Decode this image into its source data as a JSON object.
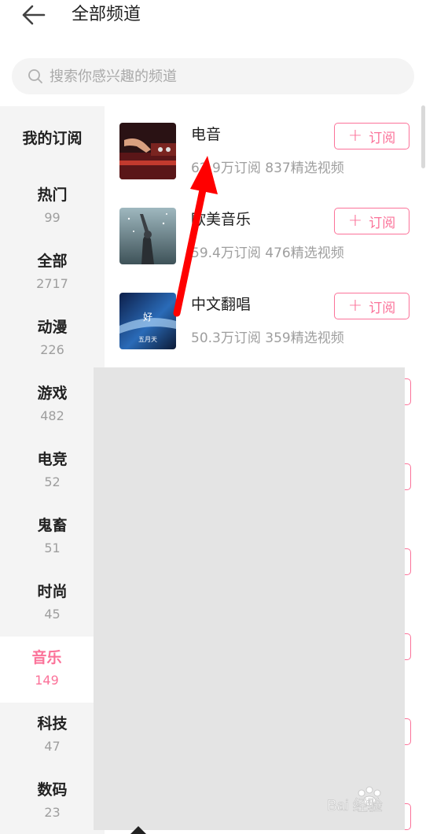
{
  "header": {
    "title": "全部频道",
    "back_icon": "arrow-left-icon"
  },
  "search": {
    "placeholder": "搜索你感兴趣的频道",
    "icon": "search-icon"
  },
  "sidebar": {
    "my_subscriptions": "我的订阅",
    "items": [
      {
        "label": "热门",
        "count": "99"
      },
      {
        "label": "全部",
        "count": "2717"
      },
      {
        "label": "动漫",
        "count": "226"
      },
      {
        "label": "游戏",
        "count": "482"
      },
      {
        "label": "电竞",
        "count": "52"
      },
      {
        "label": "鬼畜",
        "count": "51"
      },
      {
        "label": "时尚",
        "count": "45"
      },
      {
        "label": "音乐",
        "count": "149",
        "active": true
      },
      {
        "label": "科技",
        "count": "47"
      },
      {
        "label": "数码",
        "count": "23"
      }
    ]
  },
  "channels": [
    {
      "name": "电音",
      "subscribers": "62.9万订阅",
      "videos": "837精选视频"
    },
    {
      "name": "欧美音乐",
      "subscribers": "59.4万订阅",
      "videos": "476精选视频"
    },
    {
      "name": "中文翻唱",
      "subscribers": "50.3万订阅",
      "videos": "359精选视频"
    }
  ],
  "subscribe_label": "订阅",
  "thumbnail_caption": {
    "line1": "好",
    "line2": "五月天"
  },
  "watermark": {
    "text": "Bai 经验",
    "paw": "du"
  },
  "colors": {
    "accent": "#fb7299",
    "sidebar_bg": "#f4f4f4",
    "muted_text": "#9e9e9e",
    "annotation_arrow": "#ff0000"
  }
}
